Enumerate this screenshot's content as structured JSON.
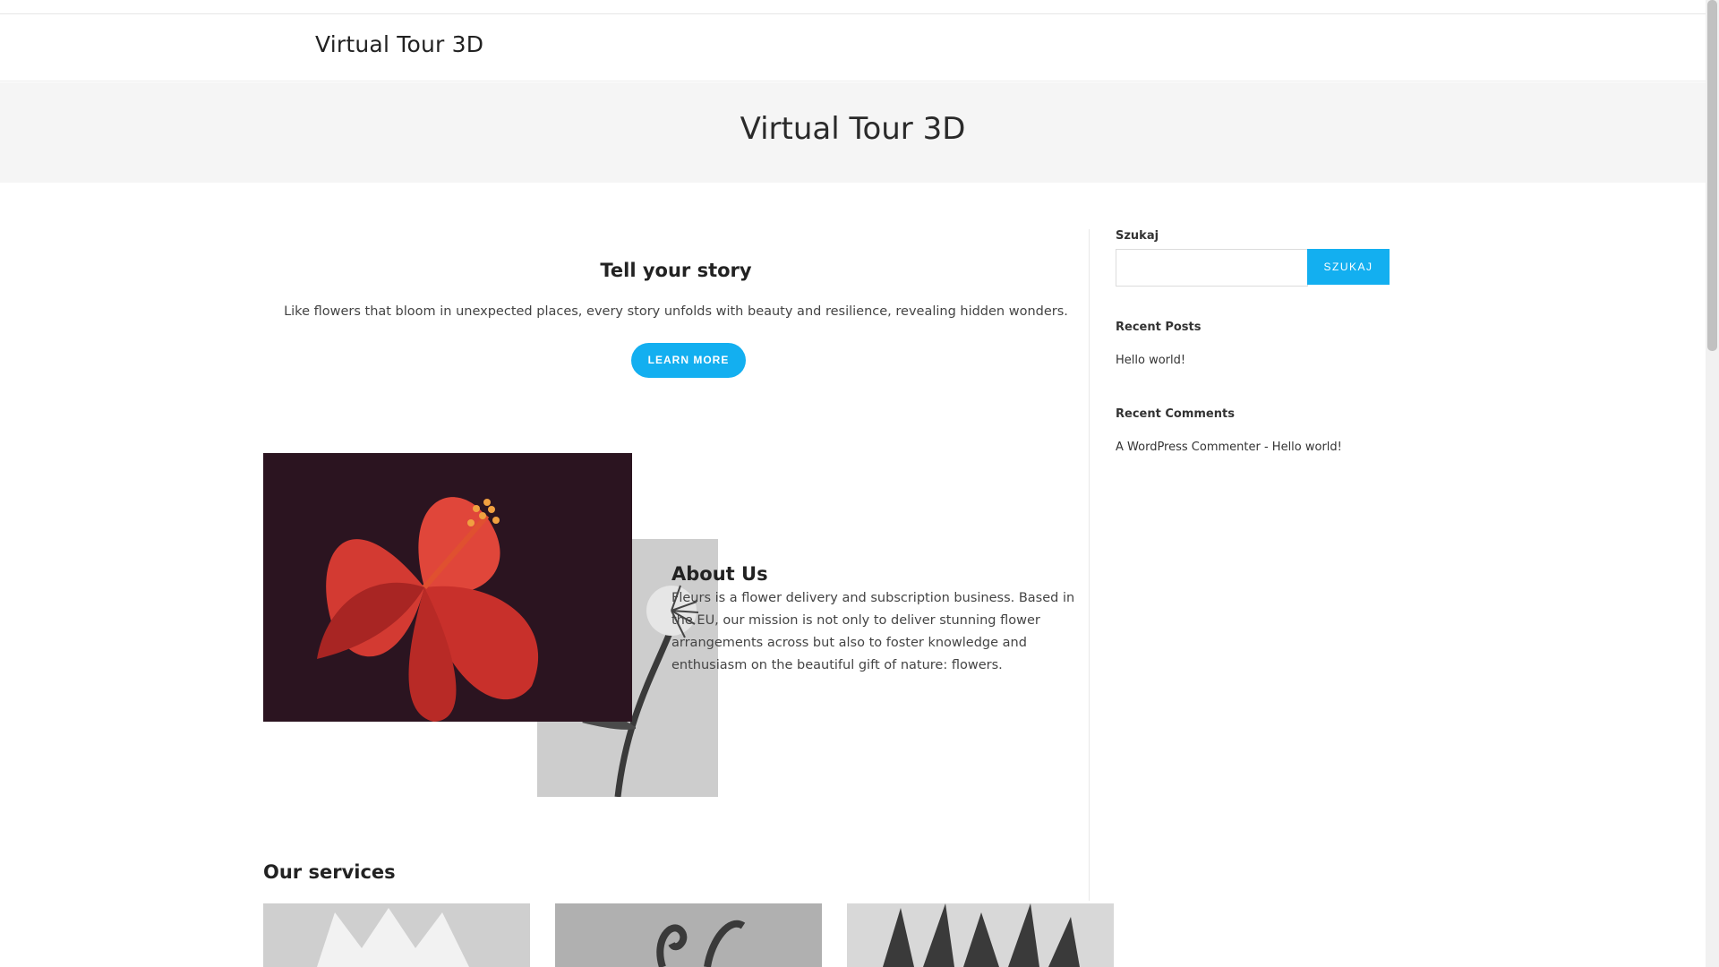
{
  "site": {
    "title": "Virtual Tour 3D"
  },
  "page_header": {
    "title": "Virtual Tour 3D"
  },
  "hero": {
    "title": "Tell your story",
    "text": "Like flowers that bloom in unexpected places, every story unfolds with beauty and resilience, revealing hidden wonders.",
    "button_label": "LEARN MORE"
  },
  "about": {
    "title": "About Us",
    "text": "Fleurs is a flower delivery and subscription business. Based in the EU, our mission is not only to deliver stunning flower arrangements across but also to foster knowledge and enthusiasm on the beautiful gift of nature: flowers."
  },
  "services": {
    "title": "Our services"
  },
  "sidebar": {
    "search_label": "Szukaj",
    "search_button": "SZUKAJ",
    "search_value": "",
    "recent_posts_title": "Recent Posts",
    "recent_posts": [
      "Hello world!"
    ],
    "recent_comments_title": "Recent Comments",
    "recent_comment": {
      "author": "A WordPress Commenter",
      "separator": " - ",
      "post": "Hello world!"
    }
  },
  "colors": {
    "accent": "#13aff0",
    "header_band": "#f5f5f5"
  }
}
